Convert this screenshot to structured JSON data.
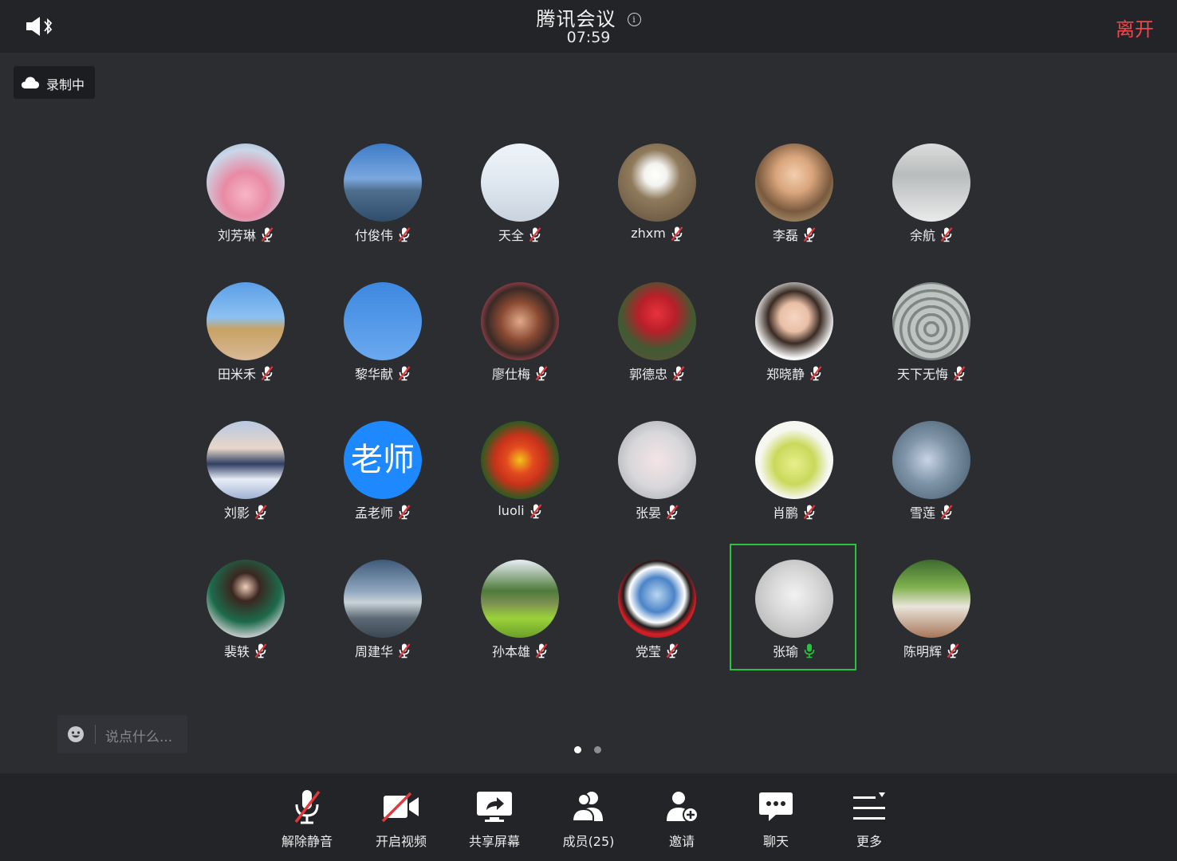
{
  "header": {
    "title": "腾讯会议",
    "timer": "07:59",
    "leave_label": "离开"
  },
  "recording": {
    "label": "录制中"
  },
  "participants": [
    {
      "name": "刘芳琳",
      "muted": true,
      "bg": "radial-gradient(circle at 50% 65%, #f7b6c5 0%, #e98aa4 35%, #c9d7e8 70%, #8fa6c7 100%)"
    },
    {
      "name": "付俊伟",
      "muted": true,
      "bg": "linear-gradient(180deg,#3d7bc8 0%,#7aa8de 45%,#4f6f8f 60%,#2f4d6b 100%)"
    },
    {
      "name": "天全",
      "muted": true,
      "bg": "linear-gradient(180deg,#eef3f8 0%,#dfe8f1 50%,#c9d3dd 100%)"
    },
    {
      "name": "zhxm",
      "muted": true,
      "bg": "radial-gradient(circle at 48% 40%, #ffffff 0%, #f3f3ef 18%, #8f7a5c 40%, #5b4b38 100%)"
    },
    {
      "name": "李磊",
      "muted": true,
      "bg": "radial-gradient(circle at 50% 40%, #f2cfae 0%, #d9a57c 30%, #7a5a3f 60%, #c8b48a 100%)"
    },
    {
      "name": "余航",
      "muted": true,
      "bg": "linear-gradient(180deg,#dcdcdc 0%,#b9bcbd 40%,#e9eaea 100%)"
    },
    {
      "name": "田米禾",
      "muted": true,
      "bg": "linear-gradient(180deg,#5b9ee6 0%,#8cc1f2 45%,#c7a264 60%,#d9b998 100%)"
    },
    {
      "name": "黎华献",
      "muted": true,
      "bg": "linear-gradient(180deg,#3d88e0 0%,#6aa9ef 100%)"
    },
    {
      "name": "廖仕梅",
      "muted": true,
      "bg": "radial-gradient(circle at 50% 50%, #e0a989 0%, #8a4a32 35%, #3a2a26 60%, #c24a5b 80%, #4d8b3c 100%)"
    },
    {
      "name": "郭德忠",
      "muted": true,
      "bg": "radial-gradient(circle at 50% 40%, #e8333b 0%, #b81f2a 30%, #3f5b33 60%, #6e4a3b 100%)"
    },
    {
      "name": "郑晓静",
      "muted": true,
      "bg": "radial-gradient(circle at 50% 45%, #f5d6c2 0%, #e9bfa6 25%, #3a2b24 45%, #f6f6f6 70%)"
    },
    {
      "name": "天下无悔",
      "muted": true,
      "bg": "repeating-radial-gradient(circle at 50% 60%, #bfc4c2 0px, #bfc4c2 6px, #7e8583 7px, #7e8583 10px)"
    },
    {
      "name": "刘影",
      "muted": true,
      "bg": "linear-gradient(180deg,#b9c8e2 0%,#e7d6c9 35%,#2f3f63 55%,#e9eef7 75%,#9fb0d3 100%)"
    },
    {
      "name": "孟老师",
      "muted": true,
      "teacher": "老师",
      "bg": "#1e88ff"
    },
    {
      "name": "luoli",
      "muted": true,
      "bg": "radial-gradient(circle at 50% 50%, #f4c21b 0%, #e24a1f 25%, #c8321a 45%, #2d5b21 70%, #1e3d16 100%)"
    },
    {
      "name": "张晏",
      "muted": true,
      "bg": "radial-gradient(circle at 50% 50%, #f4e4e6 0%, #d8d7da 50%, #9ea3a8 100%)"
    },
    {
      "name": "肖鹏",
      "muted": true,
      "bg": "radial-gradient(circle at 50% 55%, #e7ef8d 0%, #c9d95a 35%, #f7f7f2 60%)"
    },
    {
      "name": "雪莲",
      "muted": true,
      "bg": "radial-gradient(circle at 45% 50%, #c9d3e6 0%, #7f94a8 40%, #3e5566 100%)"
    },
    {
      "name": "裴轶",
      "muted": true,
      "bg": "radial-gradient(circle at 50% 35%, #f0cdb7 0%, #3a2720 22%, #1d6b4c 55%, #cfd0d2 80%)"
    },
    {
      "name": "周建华",
      "muted": true,
      "bg": "linear-gradient(180deg,#3e5a7a 0%,#8fa6bd 40%,#c9d2d8 55%,#5d6a75 75%,#3a4752 100%)"
    },
    {
      "name": "孙本雄",
      "muted": true,
      "bg": "linear-gradient(180deg,#e8eef4 0%,#4e7a3b 40%,#7a8f52 55%,#9bd23a 75%,#6a9e2a 100%)"
    },
    {
      "name": "党莹",
      "muted": true,
      "bg": "radial-gradient(circle at 50% 45%, #b9d6f0 0%, #4a83c7 30%, #ffffff 48%, #1c1c1c 58%, #d61f26 68%, #1a1a1a 100%)"
    },
    {
      "name": "张瑜",
      "muted": false,
      "active": true,
      "bg": "radial-gradient(circle at 50% 45%, #f2f2f2 0%, #d8d8d8 40%, #a9a9a9 100%)"
    },
    {
      "name": "陈明辉",
      "muted": true,
      "bg": "linear-gradient(180deg,#3d6b2f 0%,#7fb04d 35%,#e9e4da 60%,#a8765a 100%)"
    }
  ],
  "chat": {
    "placeholder": "说点什么..."
  },
  "pager": {
    "total": 2,
    "current": 1
  },
  "toolbar": [
    {
      "id": "unmute",
      "label": "解除静音",
      "icon": "mic-off-icon"
    },
    {
      "id": "video",
      "label": "开启视频",
      "icon": "video-off-icon"
    },
    {
      "id": "share",
      "label": "共享屏幕",
      "icon": "share-screen-icon"
    },
    {
      "id": "members",
      "label": "成员(25)",
      "icon": "members-icon"
    },
    {
      "id": "invite",
      "label": "邀请",
      "icon": "invite-icon"
    },
    {
      "id": "chat",
      "label": "聊天",
      "icon": "chat-icon"
    },
    {
      "id": "more",
      "label": "更多",
      "icon": "more-icon"
    }
  ],
  "colors": {
    "background": "#2b2d31",
    "bar": "#232427",
    "leave": "#f0464a",
    "active": "#2ac23e",
    "muted_slash": "#e5383b"
  }
}
